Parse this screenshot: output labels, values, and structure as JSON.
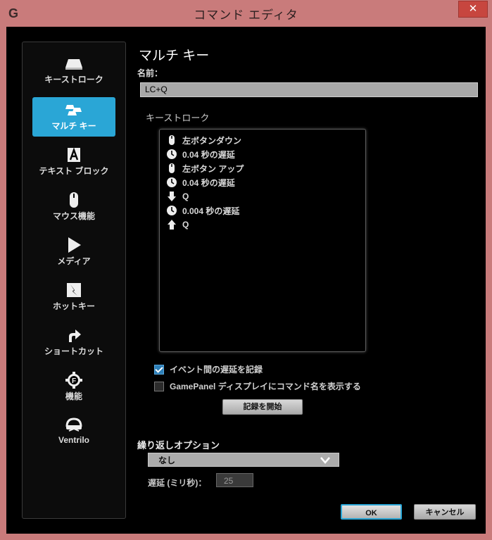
{
  "window": {
    "title": "コマンド エディタ",
    "close_glyph": "✕"
  },
  "sidebar": {
    "items": [
      {
        "label": "キーストローク",
        "icon": "key-icon"
      },
      {
        "label": "マルチ キー",
        "icon": "multi-key-icon",
        "active": true
      },
      {
        "label": "テキスト ブロック",
        "icon": "text-a-icon"
      },
      {
        "label": "マウス機能",
        "icon": "mouse-icon"
      },
      {
        "label": "メディア",
        "icon": "play-icon"
      },
      {
        "label": "ホットキー",
        "icon": "hotkey-icon"
      },
      {
        "label": "ショートカット",
        "icon": "shortcut-arrow-icon"
      },
      {
        "label": "機能",
        "icon": "function-gear-icon"
      },
      {
        "label": "Ventrilo",
        "icon": "headset-icon"
      }
    ]
  },
  "main": {
    "heading": "マルチ キー",
    "name_label": "名前：",
    "name_value": "LC+Q",
    "keystrokes_label": "キーストローク",
    "keystrokes": [
      {
        "icon": "mouse-icon",
        "text": "左ボタンダウン"
      },
      {
        "icon": "clock-icon",
        "text": "0.04 秒の遅延"
      },
      {
        "icon": "mouse-icon",
        "text": "左ボタン アップ"
      },
      {
        "icon": "clock-icon",
        "text": "0.04 秒の遅延"
      },
      {
        "icon": "arrow-down-icon",
        "text": "Q"
      },
      {
        "icon": "clock-icon",
        "text": "0.004 秒の遅延"
      },
      {
        "icon": "arrow-up-icon",
        "text": "Q"
      }
    ],
    "record_delay": {
      "label": "イベント間の遅延を記録",
      "checked": true
    },
    "gamepanel": {
      "label": "GamePanel ディスプレイにコマンド名を表示する",
      "checked": false
    },
    "record_button": "記録を開始",
    "repeat_label": "繰り返しオプション",
    "repeat_value": "なし",
    "delay_label": "遅延 (ミリ秒)：",
    "delay_value": "25"
  },
  "buttons": {
    "ok": "OK",
    "cancel": "キャンセル"
  }
}
